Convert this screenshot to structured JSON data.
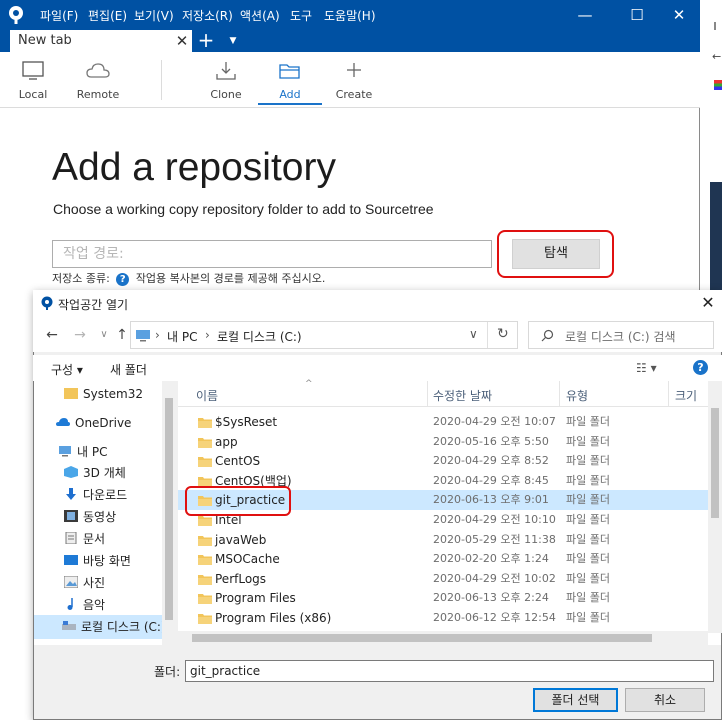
{
  "sourcetree": {
    "menu": [
      "파일(F)",
      "편집(E)",
      "보기(V)",
      "저장소(R)",
      "액션(A)",
      "도구",
      "도움말(H)"
    ],
    "window_buttons": {
      "minimize": "—",
      "maximize": "☐",
      "close": "✕"
    },
    "tab": {
      "label": "New tab",
      "close": "✕",
      "new_tab": "+",
      "tab_menu": "▼"
    },
    "toolbar": [
      {
        "label": "Local",
        "icon": "monitor-icon"
      },
      {
        "label": "Remote",
        "icon": "cloud-icon"
      },
      {
        "label": "Clone",
        "icon": "download-icon"
      },
      {
        "label": "Add",
        "icon": "folder-open-icon",
        "active": true
      },
      {
        "label": "Create",
        "icon": "plus-icon"
      }
    ],
    "heading": "Add a repository",
    "subtitle": "Choose a working copy repository folder to add to Sourcetree",
    "path_placeholder": "작업 경로:",
    "browse_label": "탐색",
    "repo_type_label": "저장소 종류:",
    "repo_type_help": "?",
    "repo_type_message": "작업용 복사본의 경로를 제공해 주십시오.",
    "accent": "#0051a3"
  },
  "dialog": {
    "title": "작업공간 열기",
    "close": "✕",
    "nav": {
      "back": "←",
      "forward": "→",
      "dropdown": "∨",
      "up": "↑",
      "refresh": "↻"
    },
    "breadcrumb": [
      "내 PC",
      "로컬 디스크 (C:)"
    ],
    "search_placeholder": "로컬 디스크 (C:) 검색",
    "commands": {
      "organize": "구성 ▾",
      "new_folder": "새 폴더",
      "view": "☷ ▾",
      "help": "?"
    },
    "sidebar": [
      {
        "label": "System32",
        "icon": "folder-icon"
      },
      {
        "label": "OneDrive",
        "icon": "cloud-icon"
      },
      {
        "label": "내 PC",
        "icon": "computer-icon"
      },
      {
        "label": "3D 개체",
        "icon": "cube-icon"
      },
      {
        "label": "다운로드",
        "icon": "download-arrow-icon"
      },
      {
        "label": "동영상",
        "icon": "film-icon"
      },
      {
        "label": "문서",
        "icon": "document-icon"
      },
      {
        "label": "바탕 화면",
        "icon": "desktop-icon"
      },
      {
        "label": "사진",
        "icon": "picture-icon"
      },
      {
        "label": "음악",
        "icon": "music-icon"
      },
      {
        "label": "로컬 디스크 (C:)",
        "icon": "drive-icon",
        "selected": true
      }
    ],
    "columns": {
      "name": "이름",
      "modified": "수정한 날짜",
      "type": "유형",
      "size": "크기"
    },
    "files": [
      {
        "name": "$SysReset",
        "modified": "2020-04-29 오전 10:07",
        "type": "파일 폴더"
      },
      {
        "name": "app",
        "modified": "2020-05-16 오후 5:50",
        "type": "파일 폴더"
      },
      {
        "name": "CentOS",
        "modified": "2020-04-29 오후 8:52",
        "type": "파일 폴더"
      },
      {
        "name": "CentOS(백업)",
        "modified": "2020-04-29 오후 8:45",
        "type": "파일 폴더"
      },
      {
        "name": "git_practice",
        "modified": "2020-06-13 오후 9:01",
        "type": "파일 폴더",
        "selected": true
      },
      {
        "name": "Intel",
        "modified": "2020-04-29 오전 10:10",
        "type": "파일 폴더"
      },
      {
        "name": "javaWeb",
        "modified": "2020-05-29 오전 11:38",
        "type": "파일 폴더"
      },
      {
        "name": "MSOCache",
        "modified": "2020-02-20 오후 1:24",
        "type": "파일 폴더"
      },
      {
        "name": "PerfLogs",
        "modified": "2020-04-29 오전 10:02",
        "type": "파일 폴더"
      },
      {
        "name": "Program Files",
        "modified": "2020-06-13 오후 2:24",
        "type": "파일 폴더"
      },
      {
        "name": "Program Files (x86)",
        "modified": "2020-06-12 오후 12:54",
        "type": "파일 폴더"
      }
    ],
    "folder_label": "폴더:",
    "folder_value": "git_practice",
    "select_button": "폴더 선택",
    "cancel_button": "취소",
    "highlight_color": "#e01010",
    "selection_color": "#cce8ff"
  }
}
